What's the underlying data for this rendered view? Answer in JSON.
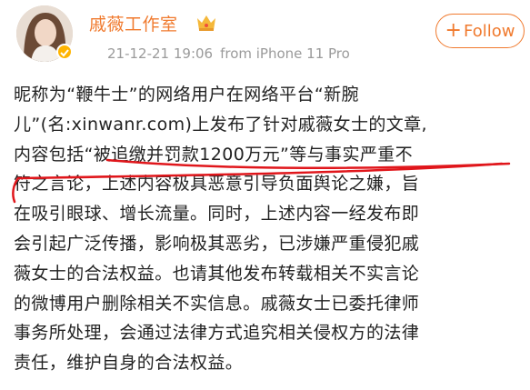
{
  "post": {
    "username": "戚薇工作室",
    "timestamp": "21-12-21 19:06",
    "source": "from iPhone 11 Pro",
    "follow_label": "Follow",
    "follow_plus": "+",
    "badge_icon": "crown-icon",
    "verified_icon": "verified-check-icon",
    "accent_color": "#f07a2e",
    "text_lines": [
      "昵称为“鞭牛士”的网络用户在网络平台“新腕",
      "儿”(名:xinwanr.com)上发布了针对戚薇女士的文章,",
      "内容包括“被追缴并罚款1200万元”等与事实严重不",
      "符之言论，上述内容极具恶意引导负面舆论之嫌，旨",
      "在吸引眼球、增长流量。同时，上述内容一经发布即",
      "会引起广泛传播，影响极其恶劣，已涉嫌严重侵犯戚",
      "薇女士的合法权益。也请其他发布转载相关不实言论",
      "的微博用户删除相关不实信息。戚薇女士已委托律师",
      "事务所处理，会通过法律方式追究相关侵权方的法律",
      "责任，维护自身的合法权益。"
    ]
  }
}
